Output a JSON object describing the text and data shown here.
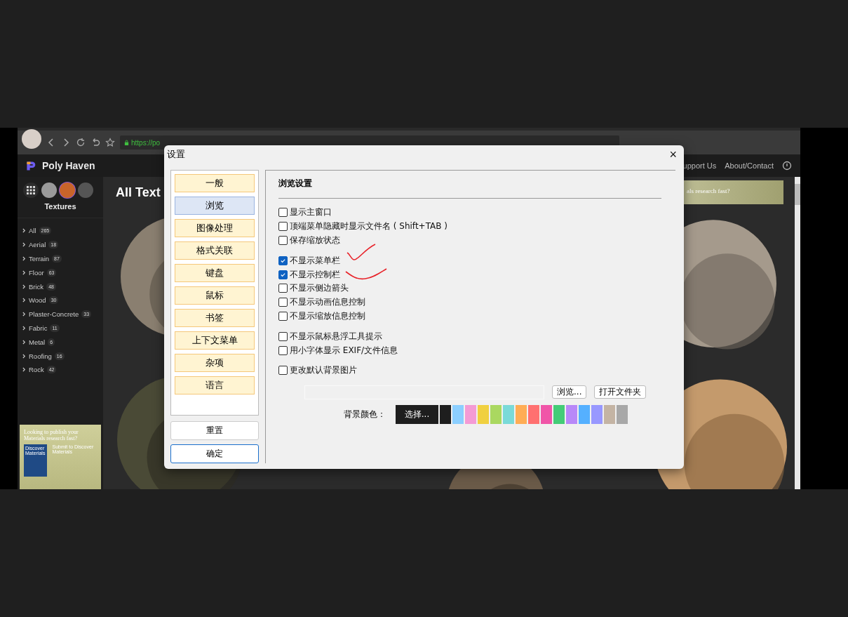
{
  "browser": {
    "url": "https://po"
  },
  "site": {
    "name": "Poly Haven",
    "section": "Textures",
    "heading": "All Text",
    "nav": [
      "upport Us",
      "About/Contact"
    ]
  },
  "categories": [
    {
      "label": "All",
      "count": "265"
    },
    {
      "label": "Aerial",
      "count": "18"
    },
    {
      "label": "Terrain",
      "count": "87"
    },
    {
      "label": "Floor",
      "count": "63"
    },
    {
      "label": "Brick",
      "count": "48"
    },
    {
      "label": "Wood",
      "count": "30"
    },
    {
      "label": "Plaster-Concrete",
      "count": "33"
    },
    {
      "label": "Fabric",
      "count": "11"
    },
    {
      "label": "Metal",
      "count": "6"
    },
    {
      "label": "Roofing",
      "count": "16"
    },
    {
      "label": "Rock",
      "count": "42"
    }
  ],
  "ads": {
    "side_title": "Looking to publish your Materials research fast?",
    "side_book": "Discover Materials",
    "side_text": "Submit to Discover Materials",
    "top_text": "als research fast?"
  },
  "dialog": {
    "title": "设置",
    "close": "×",
    "nav": [
      {
        "label": "一般",
        "selected": false
      },
      {
        "label": "浏览",
        "selected": true
      },
      {
        "label": "图像处理",
        "selected": false
      },
      {
        "label": "格式关联",
        "selected": false
      },
      {
        "label": "键盘",
        "selected": false
      },
      {
        "label": "鼠标",
        "selected": false
      },
      {
        "label": "书签",
        "selected": false
      },
      {
        "label": "上下文菜单",
        "selected": false
      },
      {
        "label": "杂项",
        "selected": false
      },
      {
        "label": "语言",
        "selected": false
      }
    ],
    "buttons": [
      "重置",
      "确定"
    ],
    "section_title": "浏览设置",
    "option_groups": [
      [
        {
          "label": "显示主窗口",
          "checked": false
        },
        {
          "label": "顶端菜单隐藏时显示文件名 ( Shift+TAB )",
          "checked": false
        },
        {
          "label": "保存缩放状态",
          "checked": false
        }
      ],
      [
        {
          "label": "不显示菜单栏",
          "checked": true
        },
        {
          "label": "不显示控制栏",
          "checked": true
        },
        {
          "label": "不显示侧边箭头",
          "checked": false
        },
        {
          "label": "不显示动画信息控制",
          "checked": false
        },
        {
          "label": "不显示缩放信息控制",
          "checked": false
        }
      ],
      [
        {
          "label": "不显示鼠标悬浮工具提示",
          "checked": false
        },
        {
          "label": "用小字体显示 EXIF/文件信息",
          "checked": false
        }
      ],
      [
        {
          "label": "更改默认背景图片",
          "checked": false
        }
      ]
    ],
    "browse_button": "浏览...",
    "open_folder_button": "打开文件夹",
    "bg_color_label": "背景颜色：",
    "choose_button": "选择...",
    "swatches": [
      {
        "color": "#1e1e1e"
      },
      {
        "color": "#8ccfff"
      },
      {
        "color": "#f49bd5"
      },
      {
        "color": "#f0d040"
      },
      {
        "color": "#aad860"
      },
      {
        "color": "#7adad8"
      },
      {
        "color": "#ffad55"
      },
      {
        "color": "#ff7070"
      },
      {
        "color": "#f055a8"
      },
      {
        "color": "#44cc77"
      },
      {
        "color": "#b888f8"
      },
      {
        "color": "#55b0ff"
      },
      {
        "color": "#9898ff"
      },
      {
        "color": "#c4b4a4"
      },
      {
        "color": "#a8a8a8"
      }
    ]
  }
}
